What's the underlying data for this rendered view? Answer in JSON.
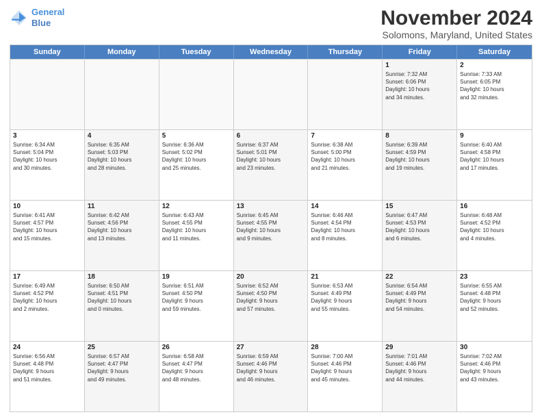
{
  "header": {
    "logo_line1": "General",
    "logo_line2": "Blue",
    "month": "November 2024",
    "location": "Solomons, Maryland, United States"
  },
  "weekdays": [
    "Sunday",
    "Monday",
    "Tuesday",
    "Wednesday",
    "Thursday",
    "Friday",
    "Saturday"
  ],
  "rows": [
    [
      {
        "day": "",
        "info": "",
        "empty": true
      },
      {
        "day": "",
        "info": "",
        "empty": true
      },
      {
        "day": "",
        "info": "",
        "empty": true
      },
      {
        "day": "",
        "info": "",
        "empty": true
      },
      {
        "day": "",
        "info": "",
        "empty": true
      },
      {
        "day": "1",
        "info": "Sunrise: 7:32 AM\nSunset: 6:06 PM\nDaylight: 10 hours\nand 34 minutes.",
        "shaded": true
      },
      {
        "day": "2",
        "info": "Sunrise: 7:33 AM\nSunset: 6:05 PM\nDaylight: 10 hours\nand 32 minutes.",
        "shaded": false
      }
    ],
    [
      {
        "day": "3",
        "info": "Sunrise: 6:34 AM\nSunset: 5:04 PM\nDaylight: 10 hours\nand 30 minutes.",
        "shaded": false
      },
      {
        "day": "4",
        "info": "Sunrise: 6:35 AM\nSunset: 5:03 PM\nDaylight: 10 hours\nand 28 minutes.",
        "shaded": true
      },
      {
        "day": "5",
        "info": "Sunrise: 6:36 AM\nSunset: 5:02 PM\nDaylight: 10 hours\nand 25 minutes.",
        "shaded": false
      },
      {
        "day": "6",
        "info": "Sunrise: 6:37 AM\nSunset: 5:01 PM\nDaylight: 10 hours\nand 23 minutes.",
        "shaded": true
      },
      {
        "day": "7",
        "info": "Sunrise: 6:38 AM\nSunset: 5:00 PM\nDaylight: 10 hours\nand 21 minutes.",
        "shaded": false
      },
      {
        "day": "8",
        "info": "Sunrise: 6:39 AM\nSunset: 4:59 PM\nDaylight: 10 hours\nand 19 minutes.",
        "shaded": true
      },
      {
        "day": "9",
        "info": "Sunrise: 6:40 AM\nSunset: 4:58 PM\nDaylight: 10 hours\nand 17 minutes.",
        "shaded": false
      }
    ],
    [
      {
        "day": "10",
        "info": "Sunrise: 6:41 AM\nSunset: 4:57 PM\nDaylight: 10 hours\nand 15 minutes.",
        "shaded": false
      },
      {
        "day": "11",
        "info": "Sunrise: 6:42 AM\nSunset: 4:56 PM\nDaylight: 10 hours\nand 13 minutes.",
        "shaded": true
      },
      {
        "day": "12",
        "info": "Sunrise: 6:43 AM\nSunset: 4:55 PM\nDaylight: 10 hours\nand 11 minutes.",
        "shaded": false
      },
      {
        "day": "13",
        "info": "Sunrise: 6:45 AM\nSunset: 4:55 PM\nDaylight: 10 hours\nand 9 minutes.",
        "shaded": true
      },
      {
        "day": "14",
        "info": "Sunrise: 6:46 AM\nSunset: 4:54 PM\nDaylight: 10 hours\nand 8 minutes.",
        "shaded": false
      },
      {
        "day": "15",
        "info": "Sunrise: 6:47 AM\nSunset: 4:53 PM\nDaylight: 10 hours\nand 6 minutes.",
        "shaded": true
      },
      {
        "day": "16",
        "info": "Sunrise: 6:48 AM\nSunset: 4:52 PM\nDaylight: 10 hours\nand 4 minutes.",
        "shaded": false
      }
    ],
    [
      {
        "day": "17",
        "info": "Sunrise: 6:49 AM\nSunset: 4:52 PM\nDaylight: 10 hours\nand 2 minutes.",
        "shaded": false
      },
      {
        "day": "18",
        "info": "Sunrise: 6:50 AM\nSunset: 4:51 PM\nDaylight: 10 hours\nand 0 minutes.",
        "shaded": true
      },
      {
        "day": "19",
        "info": "Sunrise: 6:51 AM\nSunset: 4:50 PM\nDaylight: 9 hours\nand 59 minutes.",
        "shaded": false
      },
      {
        "day": "20",
        "info": "Sunrise: 6:52 AM\nSunset: 4:50 PM\nDaylight: 9 hours\nand 57 minutes.",
        "shaded": true
      },
      {
        "day": "21",
        "info": "Sunrise: 6:53 AM\nSunset: 4:49 PM\nDaylight: 9 hours\nand 55 minutes.",
        "shaded": false
      },
      {
        "day": "22",
        "info": "Sunrise: 6:54 AM\nSunset: 4:49 PM\nDaylight: 9 hours\nand 54 minutes.",
        "shaded": true
      },
      {
        "day": "23",
        "info": "Sunrise: 6:55 AM\nSunset: 4:48 PM\nDaylight: 9 hours\nand 52 minutes.",
        "shaded": false
      }
    ],
    [
      {
        "day": "24",
        "info": "Sunrise: 6:56 AM\nSunset: 4:48 PM\nDaylight: 9 hours\nand 51 minutes.",
        "shaded": false
      },
      {
        "day": "25",
        "info": "Sunrise: 6:57 AM\nSunset: 4:47 PM\nDaylight: 9 hours\nand 49 minutes.",
        "shaded": true
      },
      {
        "day": "26",
        "info": "Sunrise: 6:58 AM\nSunset: 4:47 PM\nDaylight: 9 hours\nand 48 minutes.",
        "shaded": false
      },
      {
        "day": "27",
        "info": "Sunrise: 6:59 AM\nSunset: 4:46 PM\nDaylight: 9 hours\nand 46 minutes.",
        "shaded": true
      },
      {
        "day": "28",
        "info": "Sunrise: 7:00 AM\nSunset: 4:46 PM\nDaylight: 9 hours\nand 45 minutes.",
        "shaded": false
      },
      {
        "day": "29",
        "info": "Sunrise: 7:01 AM\nSunset: 4:46 PM\nDaylight: 9 hours\nand 44 minutes.",
        "shaded": true
      },
      {
        "day": "30",
        "info": "Sunrise: 7:02 AM\nSunset: 4:46 PM\nDaylight: 9 hours\nand 43 minutes.",
        "shaded": false
      }
    ]
  ]
}
